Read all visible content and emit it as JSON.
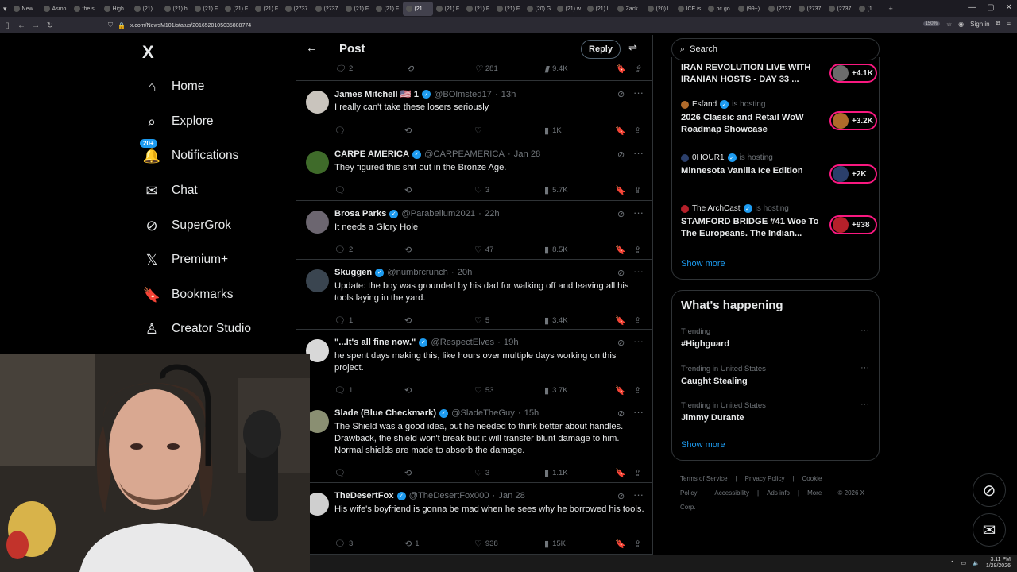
{
  "browser": {
    "tabs": [
      "New",
      "Asmo",
      "the s",
      "High",
      "(21)",
      "(21) h",
      "(21) F",
      "(21) F",
      "(21) F",
      "(2737",
      "(2737",
      "(21) F",
      "(21) F",
      "(21",
      "(21) F",
      "(21) F",
      "(21) F",
      "(20) G",
      "(21) w",
      "(21) l",
      "Zack",
      "(20) l",
      "ICE is",
      "pc go",
      "(99+)",
      "(2737",
      "(2737",
      "(2737",
      "(1"
    ],
    "active_tab_index": 13,
    "url": "x.com/NewsM101/status/2016520105035808774",
    "zoom": "150%",
    "signin_label": "Sign in"
  },
  "leftnav": {
    "logo": "X",
    "items": [
      {
        "label": "Home",
        "icon": "home-icon",
        "glyph": "⌂"
      },
      {
        "label": "Explore",
        "icon": "search-icon",
        "glyph": "⌕"
      },
      {
        "label": "Notifications",
        "icon": "bell-icon",
        "glyph": "🔔",
        "badge": "20+"
      },
      {
        "label": "Chat",
        "icon": "envelope-icon",
        "glyph": "✉"
      },
      {
        "label": "SuperGrok",
        "icon": "grok-icon",
        "glyph": "⊘"
      },
      {
        "label": "Premium+",
        "icon": "x-premium-icon",
        "glyph": "𝕏"
      },
      {
        "label": "Bookmarks",
        "icon": "bookmark-icon",
        "glyph": "🔖"
      },
      {
        "label": "Creator Studio",
        "icon": "creator-studio-icon",
        "glyph": "♙"
      }
    ]
  },
  "header": {
    "title": "Post",
    "reply_label": "Reply"
  },
  "top_actions": {
    "replies": "2",
    "reposts": "",
    "likes": "281",
    "views": "9.4K"
  },
  "tweets": [
    {
      "name": "James Mitchell 🇺🇸 1",
      "handle": "@BOlmsted17",
      "time": "13h",
      "text": "I really can't take these losers seriously",
      "replies": "",
      "reposts": "",
      "likes": "",
      "views": "1K",
      "avatar_color": "#c9c4bd"
    },
    {
      "name": "CARPE AMERICA",
      "handle": "@CARPEAMERICA",
      "time": "Jan 28",
      "text": "They figured this shit out in the Bronze Age.",
      "replies": "",
      "reposts": "",
      "likes": "3",
      "views": "5.7K",
      "avatar_color": "#3f6b2a"
    },
    {
      "name": "Brosa Parks",
      "handle": "@Parabellum2021",
      "time": "22h",
      "text": "It needs a Glory Hole",
      "replies": "2",
      "reposts": "",
      "likes": "47",
      "views": "8.5K",
      "avatar_color": "#6c6670"
    },
    {
      "name": "Skuggen",
      "handle": "@numbrcrunch",
      "time": "20h",
      "text": "Update: the boy was grounded by his dad for walking off and leaving all his tools laying in the yard.",
      "replies": "1",
      "reposts": "",
      "likes": "5",
      "views": "3.4K",
      "avatar_color": "#3a4550"
    },
    {
      "name": "\"...It's all fine now.\"",
      "handle": "@RespectElves",
      "time": "19h",
      "text": "he spent days making this, like hours over multiple days working on this project.",
      "replies": "1",
      "reposts": "",
      "likes": "53",
      "views": "3.7K",
      "avatar_color": "#d8d8d8"
    },
    {
      "name": "Slade (Blue Checkmark)",
      "handle": "@SladeTheGuy",
      "time": "15h",
      "text": "The Shield was a good idea, but he needed to think better about handles. Drawback, the shield won't break but it will transfer blunt damage to him. Normal shields are made to absorb the damage.",
      "replies": "",
      "reposts": "",
      "likes": "3",
      "views": "1.1K",
      "avatar_color": "#8a8f72"
    },
    {
      "name": "TheDesertFox",
      "handle": "@TheDesertFox000",
      "time": "Jan 28",
      "text": "His wife's boyfriend is gonna be mad when he sees why he borrowed his tools.",
      "replies": "3",
      "reposts": "1",
      "likes": "938",
      "views": "15K",
      "avatar_color": "#cfcfcf"
    }
  ],
  "search": {
    "placeholder": "Search"
  },
  "spaces": {
    "first_title": "IRAN REVOLUTION LIVE WITH IRANIAN HOSTS - DAY 33 ...",
    "first_count": "+4.1K",
    "items": [
      {
        "host": "Esfand",
        "hosting": "is hosting",
        "title": "2026 Classic and Retail WoW Roadmap Showcase",
        "count": "+3.2K",
        "color": "#b06a2a"
      },
      {
        "host": "0HOUR1",
        "hosting": "is hosting",
        "title": "Minnesota Vanilla Ice Edition",
        "count": "+2K",
        "color": "#2b3f6b"
      },
      {
        "host": "The ArchCast",
        "hosting": "is hosting",
        "title": "STAMFORD BRIDGE #41 Woe To The Europeans. The Indian...",
        "count": "+938",
        "color": "#b5202a"
      }
    ],
    "show_more": "Show more"
  },
  "happening": {
    "title": "What's happening",
    "trends": [
      {
        "context": "Trending",
        "name": "#Highguard"
      },
      {
        "context": "Trending in United States",
        "name": "Caught Stealing"
      },
      {
        "context": "Trending in United States",
        "name": "Jimmy Durante"
      }
    ],
    "show_more": "Show more"
  },
  "footer": {
    "links": [
      "Terms of Service",
      "|",
      "Privacy Policy",
      "|",
      "Cookie Policy",
      "|",
      "Accessibility",
      "|",
      "Ads info",
      "|",
      "More ···",
      "© 2026 X Corp."
    ]
  },
  "taskbar": {
    "time": "3:11 PM",
    "date": "1/29/2026"
  },
  "colors": {
    "accent": "#1d9bf0",
    "live": "#f91880",
    "muted": "#71767b",
    "border": "#2f3336"
  }
}
